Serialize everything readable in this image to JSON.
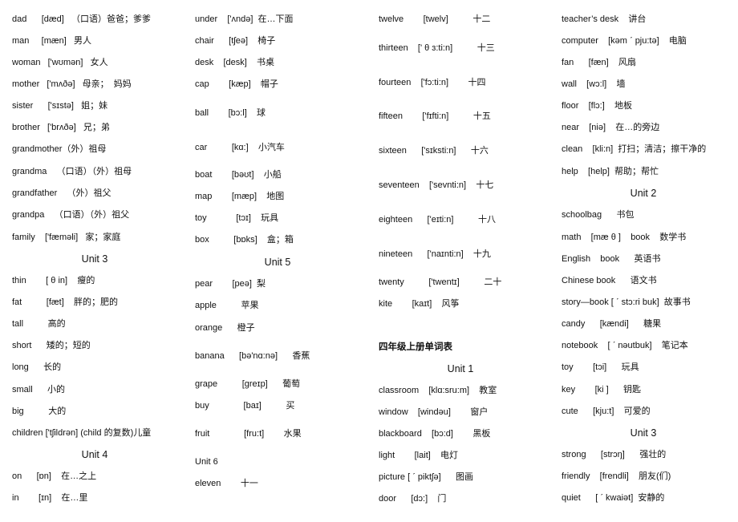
{
  "columns": [
    {
      "lines": [
        {
          "kind": "entry",
          "text": "dad      [dæd]   （口语）爸爸；爹爹"
        },
        {
          "kind": "entry",
          "text": "man     [mæn]   男人"
        },
        {
          "kind": "entry",
          "text": "woman   ['wʊmən]   女人"
        },
        {
          "kind": "entry",
          "text": "mother   ['mʌðə]   母亲；  妈妈"
        },
        {
          "kind": "entry",
          "text": "sister      ['sɪstə]   姐；妹"
        },
        {
          "kind": "entry",
          "text": "brother   ['brʌðə]   兄；弟"
        },
        {
          "kind": "entry",
          "text": "grandmother（外）祖母"
        },
        {
          "kind": "entry",
          "text": "grandma    （口语）（外）祖母"
        },
        {
          "kind": "entry",
          "text": "grandfather    （外）祖父"
        },
        {
          "kind": "entry",
          "text": "grandpa    （口语）（外）祖父"
        },
        {
          "kind": "entry",
          "text": "family    ['fæməli]   家；家庭"
        },
        {
          "kind": "unit",
          "text": "Unit 3"
        },
        {
          "kind": "entry",
          "text": "thin        [ θ in]    瘦的"
        },
        {
          "kind": "entry",
          "text": "fat          [fæt]    胖的；肥的"
        },
        {
          "kind": "entry",
          "text": "tall          高的"
        },
        {
          "kind": "entry",
          "text": "short      矮的；短的"
        },
        {
          "kind": "entry",
          "text": "long      长的"
        },
        {
          "kind": "entry",
          "text": "small      小的"
        },
        {
          "kind": "entry",
          "text": "big          大的"
        },
        {
          "kind": "entry",
          "text": "children ['tʃildrən] (child 的复数)儿童"
        },
        {
          "kind": "unit",
          "text": "Unit 4"
        },
        {
          "kind": "entry",
          "text": "on      [ɒn]    在…之上"
        },
        {
          "kind": "entry",
          "text": "in        [ɪn]    在…里"
        }
      ]
    },
    {
      "lines": [
        {
          "kind": "entry",
          "text": "under    ['ʌndə]  在…下面"
        },
        {
          "kind": "entry",
          "text": "chair      [tʃeə]    椅子"
        },
        {
          "kind": "entry",
          "text": "desk    [desk]    书桌"
        },
        {
          "kind": "entry",
          "text": "cap        [kæp]    帽子"
        },
        {
          "kind": "entry",
          "text": "ball        [bɔ:l]    球"
        },
        {
          "kind": "entry",
          "text": "car          [kɑ:]    小汽车"
        },
        {
          "kind": "entry",
          "text": "boat        [bəʊt]    小船"
        },
        {
          "kind": "entry",
          "text": "map        [mæp]    地图"
        },
        {
          "kind": "entry",
          "text": "toy            [tɔɪ]    玩具"
        },
        {
          "kind": "entry",
          "text": "box          [bɒks]    盒；箱"
        },
        {
          "kind": "unit",
          "text": "Unit 5"
        },
        {
          "kind": "entry",
          "text": "pear        [peə]  梨"
        },
        {
          "kind": "entry",
          "text": "apple          苹果"
        },
        {
          "kind": "entry",
          "text": "orange      橙子"
        },
        {
          "kind": "entry",
          "text": "banana      [bə'nɑ:nə]      香蕉"
        },
        {
          "kind": "entry",
          "text": "grape          [greɪp]      葡萄"
        },
        {
          "kind": "entry",
          "text": "buy              [baɪ]          买"
        },
        {
          "kind": "entry",
          "text": "fruit              [fru:t]        水果"
        },
        {
          "kind": "entry",
          "text": "Unit 6"
        },
        {
          "kind": "entry",
          "text": "eleven        十一"
        }
      ]
    },
    {
      "lines": [
        {
          "kind": "entry",
          "text": "twelve        [twelv]          十二"
        },
        {
          "kind": "entry",
          "text": "thirteen    [' θ ɜ:ti:n]          十三"
        },
        {
          "kind": "entry",
          "text": "fourteen    ['fɔ:ti:n]        十四"
        },
        {
          "kind": "entry",
          "text": "fifteen        ['fɪfti:n]          十五"
        },
        {
          "kind": "entry",
          "text": "sixteen      ['sɪksti:n]      十六"
        },
        {
          "kind": "entry",
          "text": "seventeen    ['sevnti:n]    十七"
        },
        {
          "kind": "entry",
          "text": "eighteen      ['eɪti:n]          十八"
        },
        {
          "kind": "entry",
          "text": "nineteen      ['naɪnti:n]    十九"
        },
        {
          "kind": "entry",
          "text": "twenty          ['twentɪ]          二十"
        },
        {
          "kind": "entry",
          "text": "kite        [kaɪt]    风筝"
        },
        {
          "kind": "heading",
          "text": "四年级上册单词表"
        },
        {
          "kind": "unit",
          "text": "Unit 1"
        },
        {
          "kind": "entry",
          "text": "classroom    [klɑ:sru:m]    教室"
        },
        {
          "kind": "entry",
          "text": "window    [windəu]        窗户"
        },
        {
          "kind": "entry",
          "text": "blackboard    [bɔ:d]        黑板"
        },
        {
          "kind": "entry",
          "text": "light        [lait]    电灯"
        },
        {
          "kind": "entry",
          "text": "picture [ ˊ piktʃə]      图画"
        },
        {
          "kind": "entry",
          "text": "door      [dɔ:]    门"
        }
      ]
    },
    {
      "lines": [
        {
          "kind": "entry",
          "text": "teacher’s desk    讲台"
        },
        {
          "kind": "entry",
          "text": "computer    [kəm ˊ pju:tə]    电脑"
        },
        {
          "kind": "entry",
          "text": "fan      [fæn]    风扇"
        },
        {
          "kind": "entry",
          "text": "wall    [wɔ:l]    墙"
        },
        {
          "kind": "entry",
          "text": "floor    [flɔ:]    地板"
        },
        {
          "kind": "entry",
          "text": "near    [niə]    在…的旁边"
        },
        {
          "kind": "entry",
          "text": "clean    [kli:n]  打扫；清洁；擦干净的"
        },
        {
          "kind": "entry",
          "text": "help    [help]  帮助；帮忙"
        },
        {
          "kind": "unit",
          "text": "Unit 2"
        },
        {
          "kind": "entry",
          "text": "schoolbag      书包"
        },
        {
          "kind": "entry",
          "text": "math    [mæ θ ]    book    数学书"
        },
        {
          "kind": "entry",
          "text": "English    book      英语书"
        },
        {
          "kind": "entry",
          "text": "Chinese book      语文书"
        },
        {
          "kind": "entry",
          "text": "story—book [ ˊ stɔ:ri buk]  故事书"
        },
        {
          "kind": "entry",
          "text": "candy      [kændi]      糖果"
        },
        {
          "kind": "entry",
          "text": "notebook    [ ˊ nəutbuk]    笔记本"
        },
        {
          "kind": "entry",
          "text": "toy        [tɔi]      玩具"
        },
        {
          "kind": "entry",
          "text": "key        [ki ]      钥匙"
        },
        {
          "kind": "entry",
          "text": "cute      [kju:t]    可爱的"
        },
        {
          "kind": "unit",
          "text": "Unit 3"
        },
        {
          "kind": "entry",
          "text": "strong      [strɔŋ]      强壮的"
        },
        {
          "kind": "entry",
          "text": "friendly    [frendli]    朋友(们)"
        },
        {
          "kind": "entry",
          "text": "quiet      [ ˊ kwaiət]  安静的"
        }
      ]
    }
  ]
}
